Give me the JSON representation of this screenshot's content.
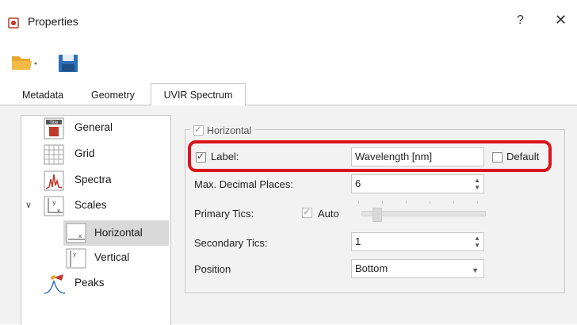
{
  "window": {
    "title": "Properties",
    "help_label": "?",
    "close_label": "✕",
    "icon": "properties-app-icon"
  },
  "toolbar": {
    "open_icon": "folder-open-icon",
    "save_icon": "floppy-save-icon"
  },
  "tabs": [
    {
      "label": "Metadata",
      "active": false
    },
    {
      "label": "Geometry",
      "active": false
    },
    {
      "label": "UVIR Spectrum",
      "active": true
    }
  ],
  "tree": {
    "items": [
      {
        "label": "General",
        "icon": "title-icon"
      },
      {
        "label": "Grid",
        "icon": "grid-icon"
      },
      {
        "label": "Spectra",
        "icon": "spectra-icon"
      },
      {
        "label": "Scales",
        "icon": "scales-icon",
        "expanded": true
      },
      {
        "label": "Horizontal",
        "icon": "x-axis-icon",
        "selected": true
      },
      {
        "label": "Vertical",
        "icon": "y-axis-icon"
      },
      {
        "label": "Peaks",
        "icon": "peaks-icon"
      }
    ]
  },
  "horizontal": {
    "group_title": "Horizontal",
    "group_checked": true,
    "label_checkbox": "Label:",
    "label_checked": true,
    "label_value": "Wavelength [nm]",
    "default_label": "Default",
    "default_checked": false,
    "max_decimal_label": "Max. Decimal Places:",
    "max_decimal_value": "6",
    "primary_tics_label": "Primary Tics:",
    "auto_label": "Auto",
    "auto_checked": true,
    "secondary_tics_label": "Secondary Tics:",
    "secondary_tics_value": "1",
    "position_label": "Position",
    "position_value": "Bottom"
  },
  "colors": {
    "highlight": "#d9141b",
    "selection": "#d9d9d9",
    "panel_bg": "#f2f2f2"
  }
}
